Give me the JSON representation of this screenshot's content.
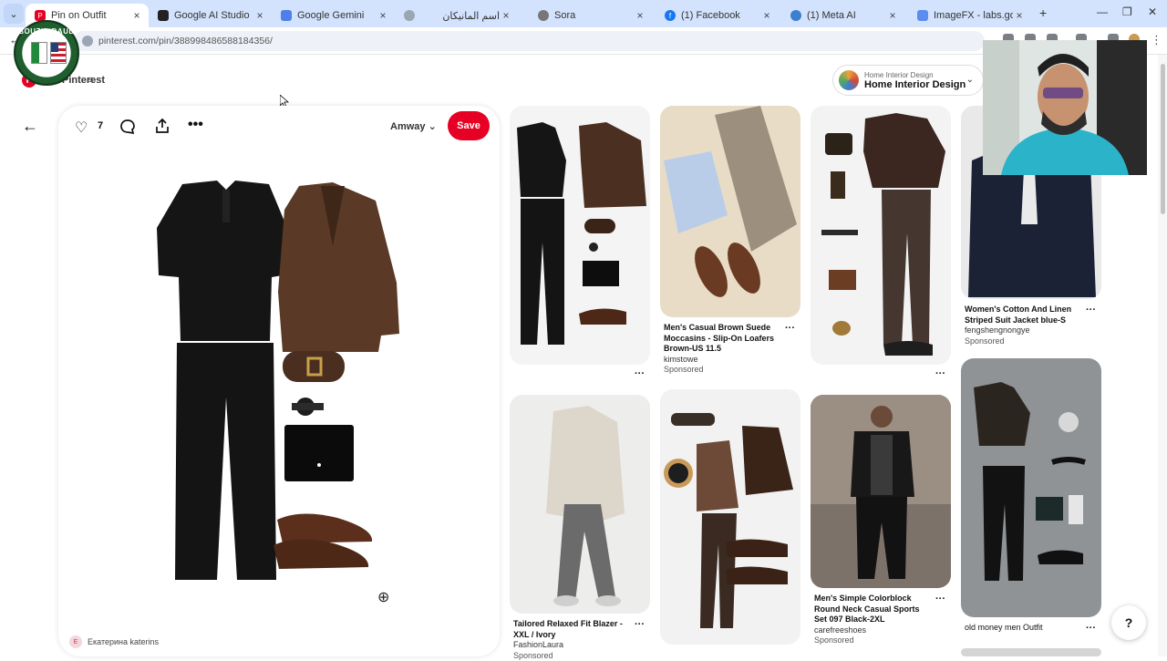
{
  "browser": {
    "tabs": [
      {
        "title": "Pin on Outfit",
        "favicon": "pinterest-icon",
        "color": "#e60023"
      },
      {
        "title": "Google AI Studio",
        "favicon": "ai-studio-icon",
        "color": "#222222"
      },
      {
        "title": "Google Gemini",
        "favicon": "gemini-icon",
        "color": "#4f7fe8"
      },
      {
        "title": "اسم المانيكان",
        "favicon": "globe-icon",
        "color": "#9aa5b5"
      },
      {
        "title": "Sora",
        "favicon": "sora-icon",
        "color": "#777777"
      },
      {
        "title": "(1) Facebook",
        "favicon": "facebook-icon",
        "color": "#1877f2"
      },
      {
        "title": "(1) Meta AI",
        "favicon": "meta-ai-icon",
        "color": "#3b7fd0"
      },
      {
        "title": "ImageFX - labs.google/fx",
        "favicon": "imagefx-icon",
        "color": "#5a8dee"
      }
    ],
    "url": "pinterest.com/pin/388998486588184356/"
  },
  "channel_logo": {
    "text": "BOUZID DAUD"
  },
  "header": {
    "logo_text": "Pinterest",
    "board_selector": {
      "small": "Home Interior Design",
      "big": "Home Interior Design"
    }
  },
  "pin": {
    "like_count": "7",
    "board": "Amway",
    "save_label": "Save",
    "author_initial": "E",
    "author_name": "Екатерина katerins"
  },
  "grid": [
    {
      "title": "",
      "source": "",
      "sponsored": ""
    },
    {
      "title": "Men's Casual Brown Suede Moccasins - Slip-On Loafers Brown-US 11.5",
      "source": "kimstowe",
      "sponsored": "Sponsored"
    },
    {
      "title": "",
      "source": "",
      "sponsored": ""
    },
    {
      "title": "Women's Cotton And Linen Striped Suit Jacket blue-S",
      "source": "fengshengnongye",
      "sponsored": "Sponsored"
    },
    {
      "title": "Tailored Relaxed Fit Blazer - XXL / Ivory",
      "source": "FashionLaura",
      "sponsored": "Sponsored"
    },
    {
      "title": "",
      "source": "",
      "sponsored": ""
    },
    {
      "title": "Men's Simple Colorblock Round Neck Casual Sports Set 097 Black-2XL",
      "source": "carefreeshoes",
      "sponsored": "Sponsored"
    },
    {
      "title": "old money men Outfit",
      "source": "",
      "sponsored": ""
    }
  ],
  "help": {
    "label": "?"
  }
}
